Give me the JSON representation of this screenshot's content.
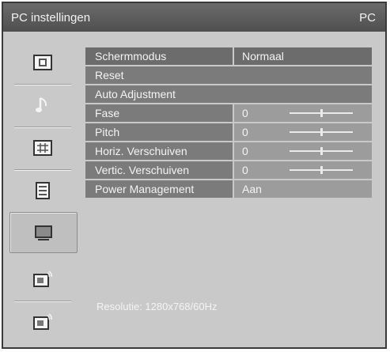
{
  "titlebar": {
    "title": "PC instellingen",
    "source": "PC"
  },
  "sidebar": {
    "items": [
      {
        "icon": "picture-icon"
      },
      {
        "icon": "music-note-icon"
      },
      {
        "icon": "grid-icon"
      },
      {
        "icon": "settings-list-icon"
      },
      {
        "icon": "monitor-icon",
        "active": true
      },
      {
        "icon": "tv-signal-icon"
      },
      {
        "icon": "tv-signal-alt-icon"
      }
    ]
  },
  "menu": {
    "schermmodus": {
      "label": "Schermmodus",
      "value": "Normaal"
    },
    "reset": {
      "label": "Reset"
    },
    "auto_adjustment": {
      "label": "Auto Adjustment"
    },
    "fase": {
      "label": "Fase",
      "value": "0",
      "level": 0.5
    },
    "pitch": {
      "label": "Pitch",
      "value": "0",
      "level": 0.5
    },
    "horiz": {
      "label": "Horiz. Verschuiven",
      "value": "0",
      "level": 0.5
    },
    "vertic": {
      "label": "Vertic. Verschuiven",
      "value": "0",
      "level": 0.5
    },
    "power": {
      "label": "Power Management",
      "value": "Aan"
    }
  },
  "status": {
    "resolution": "Resolutie: 1280x768/60Hz"
  },
  "colors": {
    "title_bg": "#555555",
    "panel_bg": "#c9c9c9",
    "row_label": "#7b7b7b",
    "row_value": "#9c9c9c",
    "text": "#f4f4f4"
  }
}
